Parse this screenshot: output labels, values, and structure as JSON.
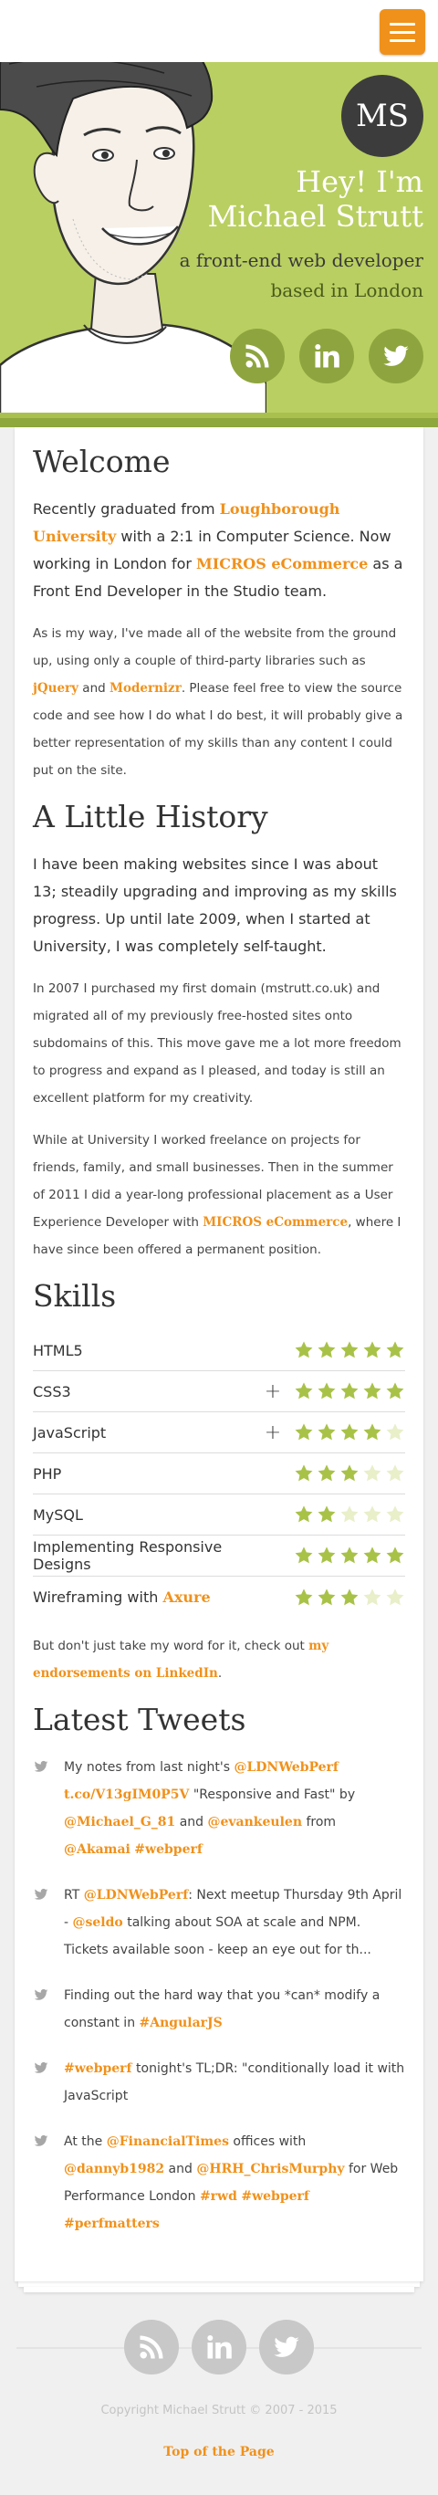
{
  "colors": {
    "accent": "#f0911b",
    "hero_bg": "#b9cf61",
    "hero_circle": "#8ea53f",
    "star_on": "#a8c248",
    "star_off": "#e8efc9"
  },
  "header": {
    "menu_icon": "hamburger-icon"
  },
  "hero": {
    "monogram": "MS",
    "hello_line1": "Hey! I'm",
    "hello_line2": "Michael Strutt",
    "tag_prefix": "a",
    "tag_role": "front-end web developer",
    "tag_location": "based in London",
    "social": [
      "rss-icon",
      "linkedin-icon",
      "twitter-icon"
    ]
  },
  "welcome": {
    "heading": "Welcome",
    "p1_a": "Recently graduated from ",
    "p1_link1": "Loughborough University",
    "p1_b": " with a 2:1 in Computer Science. Now working in London for ",
    "p1_link2": "MICROS eCommerce",
    "p1_c": " as a Front End Developer in the Studio team.",
    "p2_a": "As is my way, I've made all of the website from the ground up, using only a couple of third-party libraries such as ",
    "p2_link1": "jQuery",
    "p2_b": " and ",
    "p2_link2": "Modernizr",
    "p2_c": ". Please feel free to view the source code and see how I do what I do best, it will probably give a better representation of my skills than any content I could put on the site."
  },
  "history": {
    "heading": "A Little History",
    "p1": "I have been making websites since I was about 13; steadily upgrading and improving as my skills progress. Up until late 2009, when I started at University, I was completely self-taught.",
    "p2": "In 2007 I purchased my first domain (mstrutt.co.uk) and migrated all of my previously free-hosted sites onto subdomains of this. This move gave me a lot more freedom to progress and expand as I pleased, and today is still an excellent platform for my creativity.",
    "p3_a": "While at University I worked freelance on projects for friends, family, and small businesses. Then in the summer of 2011 I did a year-long professional placement as a User Experience Developer with ",
    "p3_link": "MICROS eCommerce",
    "p3_b": ", where I have since been offered a permanent position."
  },
  "skills": {
    "heading": "Skills",
    "items": [
      {
        "name": "HTML5",
        "link": "",
        "rating": 5,
        "expandable": false
      },
      {
        "name": "CSS3",
        "link": "",
        "rating": 5,
        "expandable": true
      },
      {
        "name": "JavaScript",
        "link": "",
        "rating": 4,
        "expandable": true
      },
      {
        "name": "PHP",
        "link": "",
        "rating": 3,
        "expandable": false
      },
      {
        "name": "MySQL",
        "link": "",
        "rating": 2,
        "expandable": false
      },
      {
        "name": "Implementing Responsive Designs",
        "link": "",
        "rating": 5,
        "expandable": false
      },
      {
        "name": "Wireframing with ",
        "link": "Axure",
        "rating": 3,
        "expandable": false
      }
    ],
    "plus_symbol": "+",
    "endorse_a": "But don't just take my word for it, check out ",
    "endorse_link": "my endorsements on LinkedIn",
    "endorse_b": "."
  },
  "tweets": {
    "heading": "Latest Tweets",
    "items": [
      [
        {
          "t": "My notes from last night's "
        },
        {
          "l": "@LDNWebPerf"
        },
        {
          "t": " "
        },
        {
          "l": "t.co/V13gIM0P5V"
        },
        {
          "t": " \"Responsive and Fast\" by "
        },
        {
          "l": "@Michael_G_81"
        },
        {
          "t": " and "
        },
        {
          "l": "@evankeulen"
        },
        {
          "t": " from "
        },
        {
          "l": "@Akamai"
        },
        {
          "t": " "
        },
        {
          "l": "#webperf"
        }
      ],
      [
        {
          "t": "RT "
        },
        {
          "l": "@LDNWebPerf"
        },
        {
          "t": ": Next meetup Thursday 9th April - "
        },
        {
          "l": "@seldo"
        },
        {
          "t": " talking about SOA at scale and NPM. Tickets available soon - keep an eye out for th..."
        }
      ],
      [
        {
          "t": "Finding out the hard way that you *can* modify a constant in "
        },
        {
          "l": "#AngularJS"
        }
      ],
      [
        {
          "l": "#webperf"
        },
        {
          "t": " tonight's TL;DR: \"conditionally load it with JavaScript"
        }
      ],
      [
        {
          "t": "At the "
        },
        {
          "l": "@FinancialTimes"
        },
        {
          "t": " offices with "
        },
        {
          "l": "@dannyb1982"
        },
        {
          "t": " and "
        },
        {
          "l": "@HRH_ChrisMurphy"
        },
        {
          "t": " for Web Performance London "
        },
        {
          "l": "#rwd"
        },
        {
          "t": " "
        },
        {
          "l": "#webperf"
        },
        {
          "t": " "
        },
        {
          "l": "#perfmatters"
        }
      ]
    ]
  },
  "footer": {
    "social": [
      "rss-icon",
      "linkedin-icon",
      "twitter-icon"
    ],
    "copyright": "Copyright Michael Strutt © 2007 - 2015",
    "top_link": "Top of the Page"
  }
}
